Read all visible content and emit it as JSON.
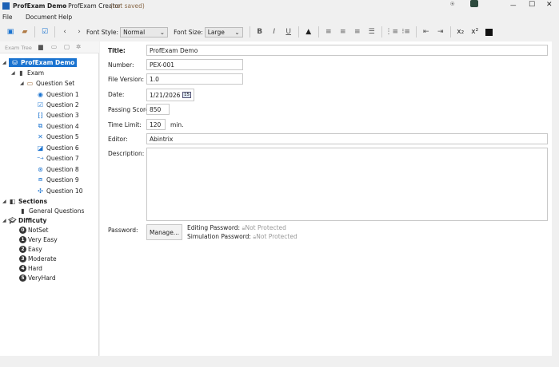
{
  "window": {
    "doc_title": "ProfExam Demo",
    "app_title": "- ProfExam Creator",
    "status": "(not saved)"
  },
  "menu": [
    "File",
    "Document",
    "Help"
  ],
  "toolbar": {
    "font_style_label": "Font Style:",
    "font_style_value": "Normal",
    "font_size_label": "Font Size:",
    "font_size_value": "Large"
  },
  "tree": {
    "label": "Exam Tree",
    "root": "ProfExam Demo",
    "exam": "Exam",
    "question_set": "Question Set",
    "questions": [
      "Question 1",
      "Question 2",
      "Question 3",
      "Question 4",
      "Question 5",
      "Question 6",
      "Question 7",
      "Question 8",
      "Question 9",
      "Question 10"
    ],
    "sections": "Sections",
    "general": "General Questions",
    "difficulty": "Difficuty",
    "levels": [
      {
        "n": "0",
        "label": "NotSet"
      },
      {
        "n": "1",
        "label": "Very Easy"
      },
      {
        "n": "2",
        "label": "Easy"
      },
      {
        "n": "3",
        "label": "Moderate"
      },
      {
        "n": "4",
        "label": "Hard"
      },
      {
        "n": "5",
        "label": "VeryHard"
      }
    ]
  },
  "form": {
    "title_label": "Title:",
    "title": "ProfExam Demo",
    "number_label": "Number:",
    "number": "PEX-001",
    "version_label": "File Version:",
    "version": "1.0",
    "date_label": "Date:",
    "date": "1/21/2026",
    "date_icon": "15",
    "passing_label": "Passing Score:",
    "passing": "850",
    "time_label": "Time Limit:",
    "time": "120",
    "time_unit": "min.",
    "editor_label": "Editor:",
    "editor": "Abintrix",
    "description_label": "Description:",
    "description": "",
    "password_label": "Password:",
    "manage": "Manage...",
    "editing_label": "Editing Password:",
    "editing_status": "Not Protected",
    "sim_label": "Simulation Password:",
    "sim_status": "Not Protected"
  }
}
